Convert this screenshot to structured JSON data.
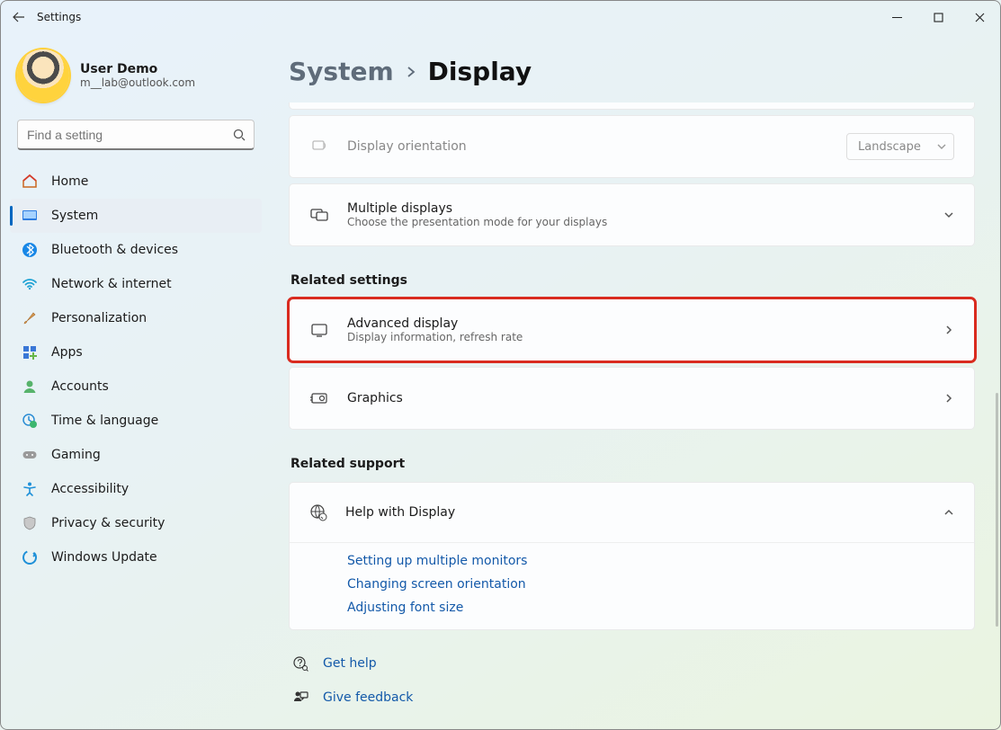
{
  "app": {
    "title": "Settings"
  },
  "user": {
    "name": "User Demo",
    "email": "m__lab@outlook.com"
  },
  "search": {
    "placeholder": "Find a setting"
  },
  "nav": {
    "items": [
      {
        "label": "Home"
      },
      {
        "label": "System"
      },
      {
        "label": "Bluetooth & devices"
      },
      {
        "label": "Network & internet"
      },
      {
        "label": "Personalization"
      },
      {
        "label": "Apps"
      },
      {
        "label": "Accounts"
      },
      {
        "label": "Time & language"
      },
      {
        "label": "Gaming"
      },
      {
        "label": "Accessibility"
      },
      {
        "label": "Privacy & security"
      },
      {
        "label": "Windows Update"
      }
    ]
  },
  "breadcrumb": {
    "root": "System",
    "leaf": "Display"
  },
  "rows": {
    "orientation": {
      "title": "Display orientation",
      "value": "Landscape"
    },
    "multi": {
      "title": "Multiple displays",
      "sub": "Choose the presentation mode for your displays"
    },
    "advanced": {
      "title": "Advanced display",
      "sub": "Display information, refresh rate"
    },
    "graphics": {
      "title": "Graphics"
    }
  },
  "sections": {
    "related": "Related settings",
    "support": "Related support"
  },
  "help": {
    "title": "Help with Display",
    "links": [
      "Setting up multiple monitors",
      "Changing screen orientation",
      "Adjusting font size"
    ]
  },
  "footer": {
    "getHelp": "Get help",
    "feedback": "Give feedback"
  }
}
